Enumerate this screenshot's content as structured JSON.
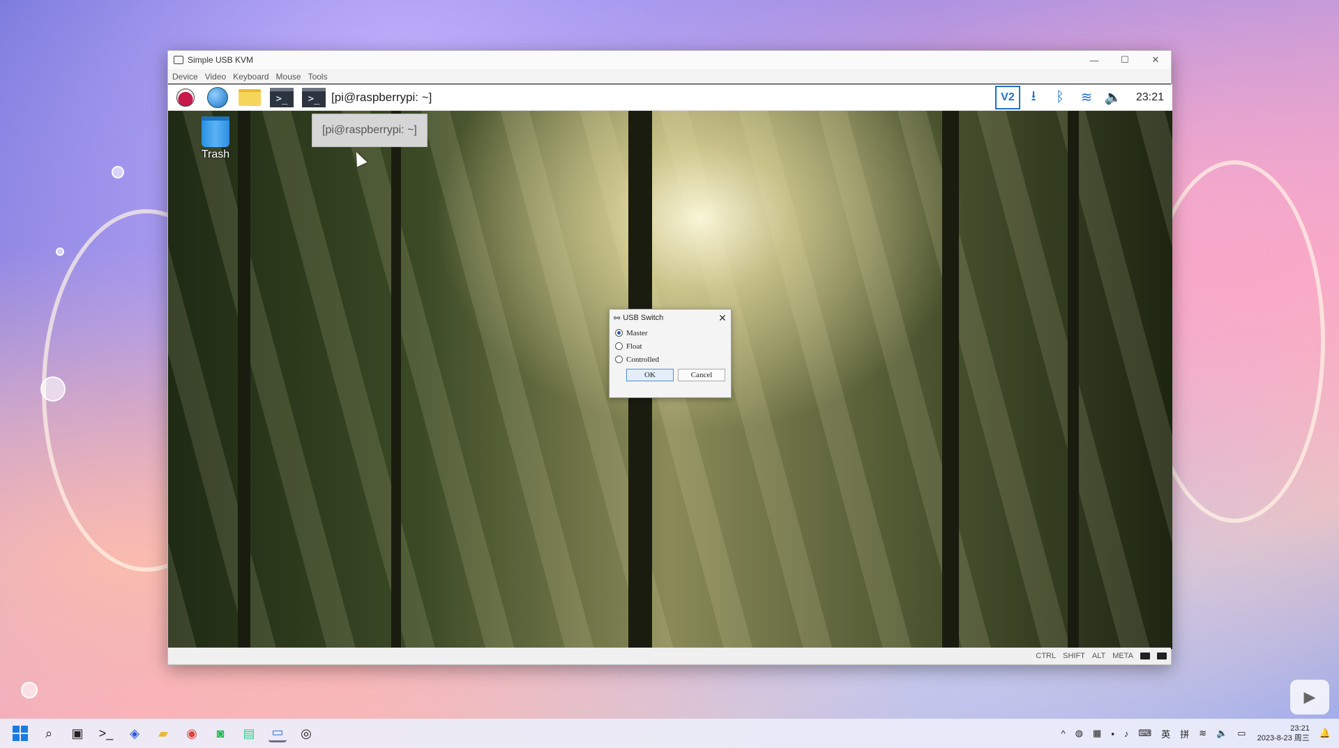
{
  "window": {
    "title": "Simple USB KVM",
    "controls": {
      "minimize": "—",
      "maximize": "☐",
      "close": "✕"
    },
    "menu": [
      "Device",
      "Video",
      "Keyboard",
      "Mouse",
      "Tools"
    ]
  },
  "pi_panel": {
    "terminal_glyph": ">_",
    "window_task": "[pi@raspberrypi: ~]",
    "tray_icons": [
      "vnc-icon",
      "download-icon",
      "bluetooth-icon",
      "wifi-icon",
      "volume-icon"
    ],
    "vnc_label": "V2",
    "clock": "23:21"
  },
  "desktop": {
    "trash_label": "Trash",
    "tooltip": "[pi@raspberrypi: ~]"
  },
  "dialog": {
    "title": "USB Switch",
    "close": "✕",
    "options": [
      {
        "label": "Master",
        "checked": true
      },
      {
        "label": "Float",
        "checked": false
      },
      {
        "label": "Controlled",
        "checked": false
      }
    ],
    "ok": "OK",
    "cancel": "Cancel"
  },
  "status_bar": {
    "keys": [
      "CTRL",
      "SHIFT",
      "ALT",
      "META"
    ]
  },
  "taskbar": {
    "icons": [
      "start-icon",
      "search-icon",
      "task-view-icon",
      "terminal-icon",
      "app-icon",
      "file-explorer-icon",
      "chrome-icon",
      "app-green-icon",
      "pycharm-icon",
      "kvm-app-icon",
      "obs-icon"
    ],
    "tray": {
      "chevron": "^",
      "ime_lang": "英",
      "ime_mode": "拼"
    },
    "time": "23:21",
    "date": "2023-8-23 周三"
  },
  "colors": {
    "accent": "#1d72c7",
    "windows_blue": "#1a7be0",
    "raspberry": "#c51a4a"
  }
}
